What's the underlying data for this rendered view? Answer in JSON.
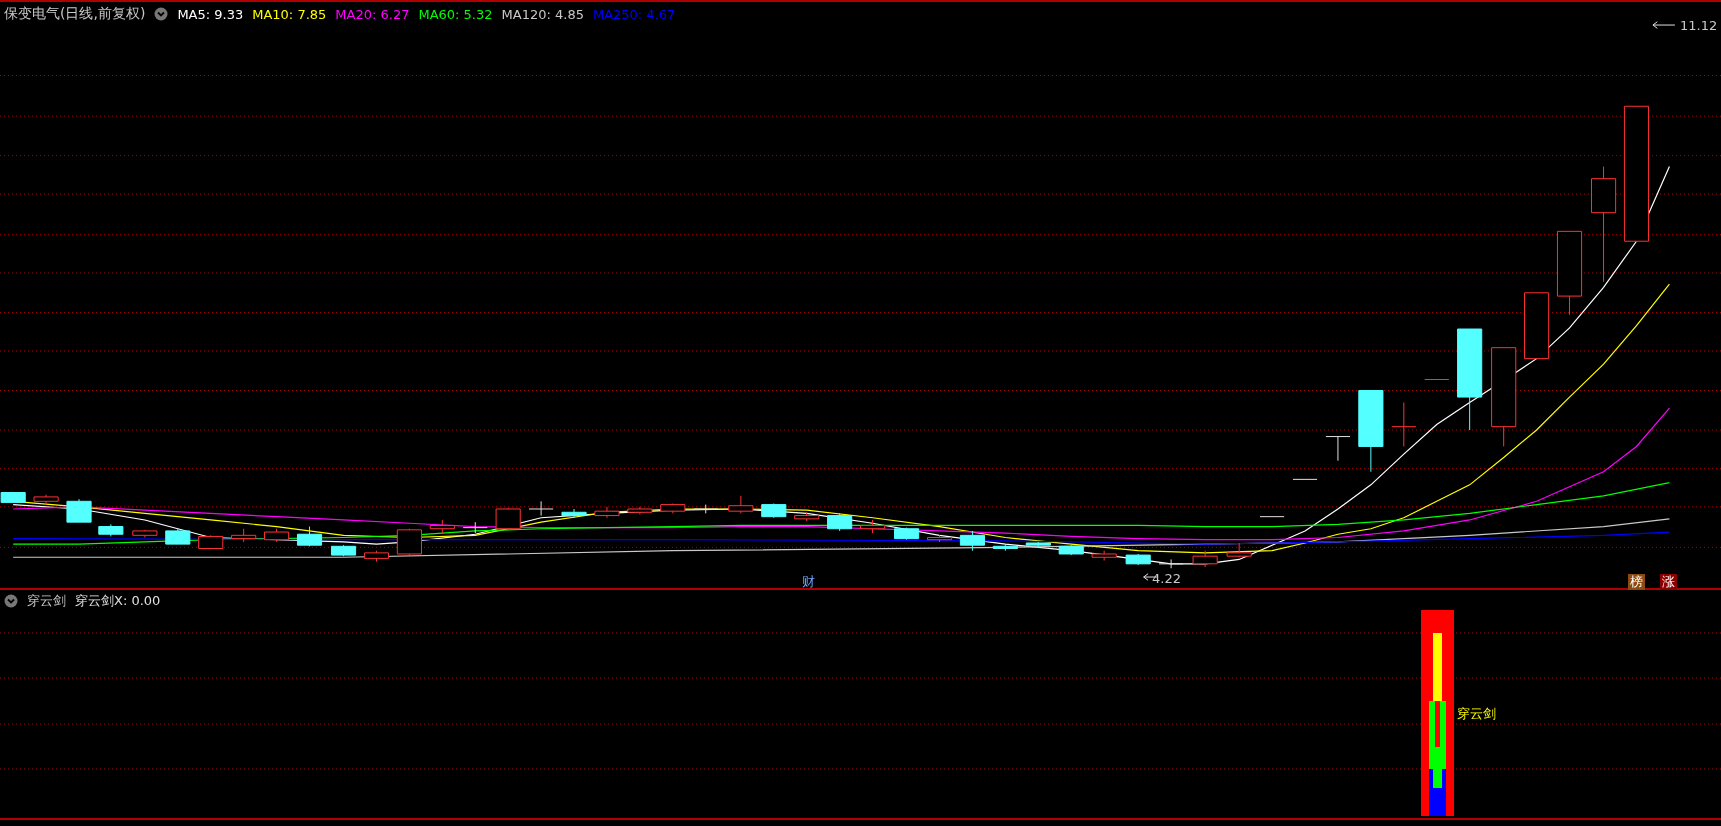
{
  "main_chart": {
    "title": "保变电气(日线,前复权)",
    "moving_averages": [
      {
        "label": "MA5: 9.33",
        "color": "#ffffff"
      },
      {
        "label": "MA10: 7.85",
        "color": "#ffff00"
      },
      {
        "label": "MA20: 6.27",
        "color": "#ff00ff"
      },
      {
        "label": "MA60: 5.32",
        "color": "#00ff00"
      },
      {
        "label": "MA120: 4.85",
        "color": "#c8c8c8"
      },
      {
        "label": "MA250: 4.67",
        "color": "#0000ff"
      }
    ],
    "high_label": "11.12",
    "low_label": "4.22",
    "markers": [
      {
        "text": "财",
        "kind": "text",
        "color": "#6fa8ff"
      },
      {
        "text": "榜",
        "kind": "badge",
        "color": "#8b4a10"
      },
      {
        "text": "涨",
        "kind": "badge",
        "color": "#8b0000"
      }
    ]
  },
  "indicator": {
    "name": "穿云剑",
    "value": "穿云剑X: 0.00",
    "signal_label": "穿云剑"
  }
}
